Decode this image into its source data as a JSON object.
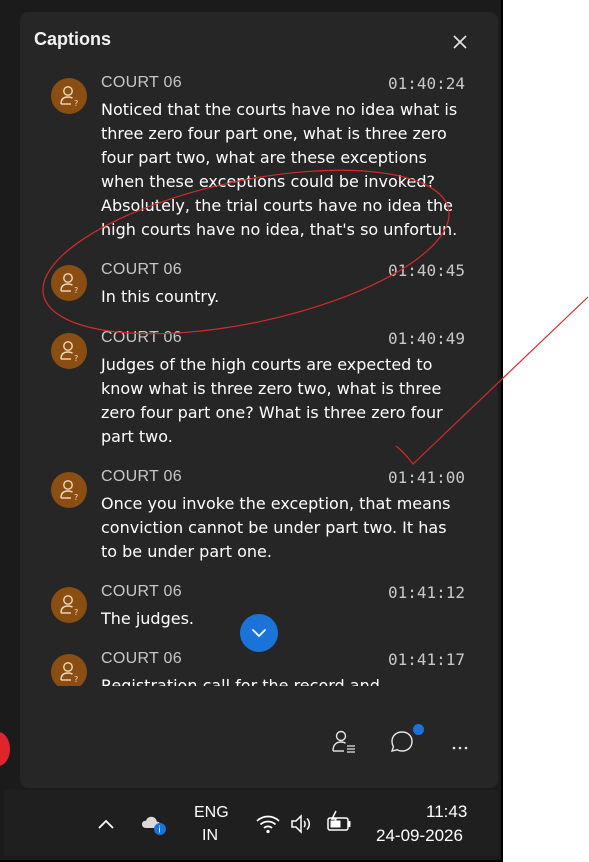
{
  "panel": {
    "title": "Captions"
  },
  "captions": [
    {
      "speaker": "COURT 06",
      "time": "01:40:24",
      "text": "Noticed that the courts have no idea what is three zero four part one, what is three zero four part two, what are these exceptions when these exceptions could be invoked? Absolutely, the trial courts have no idea the high courts have no idea, that's so unfortun."
    },
    {
      "speaker": "COURT 06",
      "time": "01:40:45",
      "text": "In this country."
    },
    {
      "speaker": "COURT 06",
      "time": "01:40:49",
      "text": "Judges of the high courts are expected to know what is three zero two, what is three zero four part one? What is three zero four part two."
    },
    {
      "speaker": "COURT 06",
      "time": "01:41:00",
      "text": "Once you invoke the exception, that means conviction cannot be under part two. It has to be under part one."
    },
    {
      "speaker": "COURT 06",
      "time": "01:41:12",
      "text": "The judges."
    },
    {
      "speaker": "COURT 06",
      "time": "01:41:17",
      "text": "Registration call for the record and"
    }
  ],
  "icons": {
    "close": "close-icon",
    "avatar": "person-unknown-icon",
    "scroll_down": "chevron-down-icon",
    "participants": "participants-list-icon",
    "chat": "chat-bubble-icon",
    "more": "more-icon"
  },
  "taskbar": {
    "language_line1": "ENG",
    "language_line2": "IN",
    "clock_time": "11:43",
    "clock_date": "24-09-2026"
  },
  "colors": {
    "panel_bg": "#262626",
    "avatar_bg": "#8a4e12",
    "accent_blue": "#1a73d9",
    "annotation_red": "#d22b2b"
  }
}
